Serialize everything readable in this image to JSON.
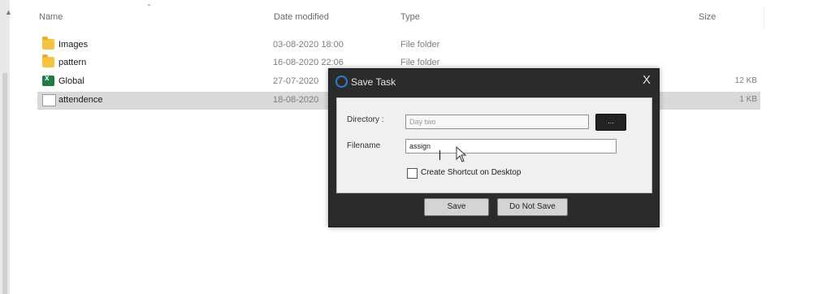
{
  "columns": {
    "name": "Name",
    "date_modified": "Date modified",
    "type": "Type",
    "size": "Size"
  },
  "files": [
    {
      "name": "Images",
      "date": "03-08-2020 18:00",
      "type": "File folder",
      "size": "",
      "icon": "folder-icon",
      "selected": false
    },
    {
      "name": "pattern",
      "date": "16-08-2020 22:06",
      "type": "File folder",
      "size": "",
      "icon": "folder-icon",
      "selected": false
    },
    {
      "name": "Global",
      "date": "27-07-2020",
      "type": "",
      "size": "12 KB",
      "icon": "excel-icon",
      "selected": false
    },
    {
      "name": "attendence",
      "date": "18-08-2020",
      "type": "",
      "size": "1 KB",
      "icon": "text-file-icon",
      "selected": true
    }
  ],
  "dialog": {
    "title": "Save Task",
    "close_label": "X",
    "directory_label": "Directory :",
    "directory_value": "Day two",
    "browse_label": "...",
    "filename_label": "Filename",
    "filename_value": "assign",
    "shortcut_label": "Create Shortcut on Desktop",
    "shortcut_checked": false,
    "save_label": "Save",
    "dont_save_label": "Do Not Save"
  },
  "colors": {
    "dialog_bg": "#2b2b2b",
    "panel_bg": "#f0f0f0",
    "selected_row": "#d9d9d9",
    "title_icon": "#2a7fd0"
  }
}
